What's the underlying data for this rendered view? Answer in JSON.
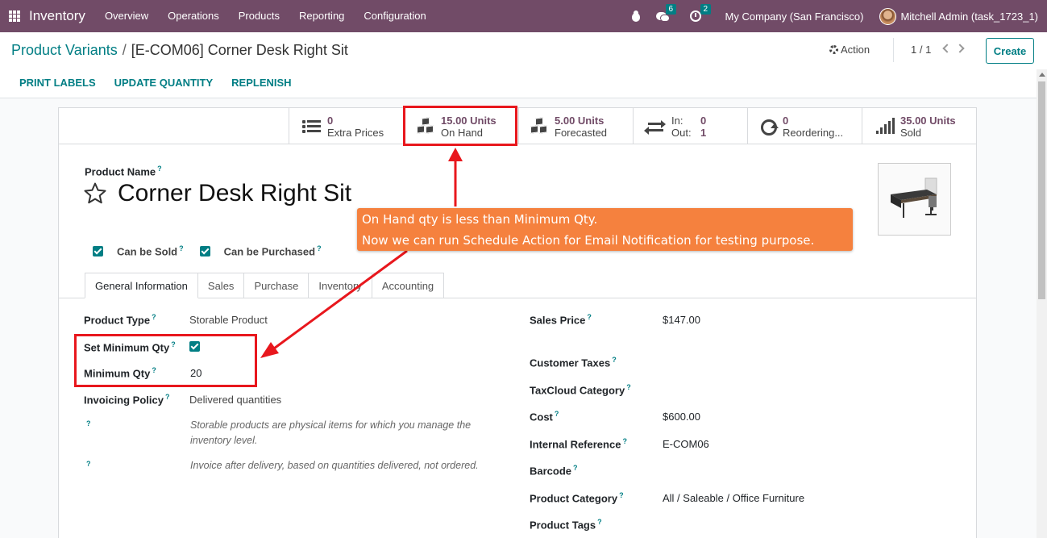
{
  "navbar": {
    "app_name": "Inventory",
    "menu": [
      "Overview",
      "Operations",
      "Products",
      "Reporting",
      "Configuration"
    ],
    "messages_count": "6",
    "activities_count": "2",
    "company": "My Company (San Francisco)",
    "user": "Mitchell Admin (task_1723_1)",
    "bg_color": "#714b67"
  },
  "control": {
    "breadcrumb_parent": "Product Variants",
    "breadcrumb_separator": "/",
    "breadcrumb_current": "[E-COM06] Corner Desk Right Sit",
    "action_label": "Action",
    "pager": "1 / 1",
    "create_label": "Create",
    "actions": [
      "PRINT LABELS",
      "UPDATE QUANTITY",
      "REPLENISH"
    ]
  },
  "stats": {
    "extra_prices": {
      "value": "0",
      "label": "Extra Prices"
    },
    "on_hand": {
      "value": "15.00 Units",
      "label": "On Hand"
    },
    "forecasted": {
      "value": "5.00 Units",
      "label": "Forecasted"
    },
    "in_out": {
      "in_label": "In:",
      "in_value": "0",
      "out_label": "Out:",
      "out_value": "1"
    },
    "reordering": {
      "value": "0",
      "label": "Reordering..."
    },
    "sold": {
      "value": "35.00 Units",
      "label": "Sold"
    }
  },
  "product": {
    "name_label": "Product Name",
    "name": "Corner Desk Right Sit",
    "can_be_sold_label": "Can be Sold",
    "can_be_purchased_label": "Can be Purchased",
    "help_mark": "?"
  },
  "tabs": [
    "General Information",
    "Sales",
    "Purchase",
    "Inventory",
    "Accounting"
  ],
  "general": {
    "product_type_label": "Product Type",
    "product_type": "Storable Product",
    "set_min_qty_label": "Set Minimum Qty",
    "min_qty_label": "Minimum Qty",
    "min_qty": "20",
    "invoicing_policy_label": "Invoicing Policy",
    "invoicing_policy": "Delivered quantities",
    "help_1": "Storable products are physical items for which you manage the inventory level.",
    "help_2": "Invoice after delivery, based on quantities delivered, not ordered.",
    "sales_price_label": "Sales Price",
    "sales_price": "$147.00",
    "customer_taxes_label": "Customer Taxes",
    "taxcloud_label": "TaxCloud Category",
    "cost_label": "Cost",
    "cost": "$600.00",
    "internal_ref_label": "Internal Reference",
    "internal_ref": "E-COM06",
    "barcode_label": "Barcode",
    "category_label": "Product Category",
    "category": "All / Saleable / Office Furniture",
    "tags_label": "Product Tags"
  },
  "callout": {
    "line1": "On Hand qty is less than Minimum Qty.",
    "line2": "Now we can run Schedule Action for Email Notification for testing purpose.",
    "color": "#f5813e"
  },
  "annotation_color": "#e8171d"
}
